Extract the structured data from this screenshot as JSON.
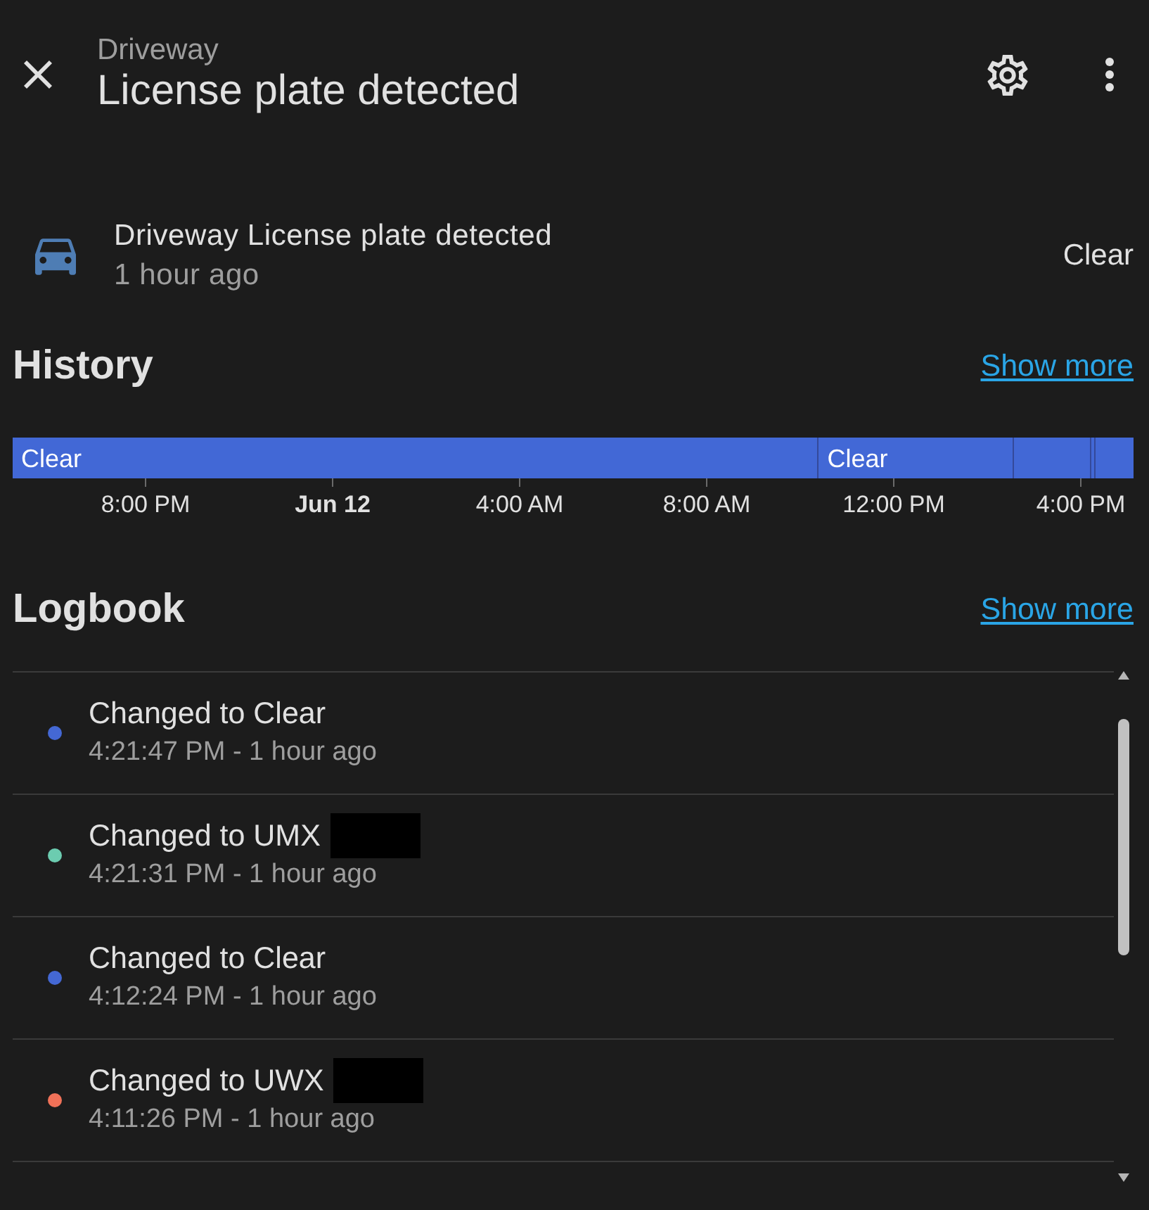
{
  "header": {
    "subtitle": "Driveway",
    "title": "License plate detected"
  },
  "entity": {
    "name": "Driveway License plate detected",
    "last_changed": "1 hour ago",
    "state": "Clear"
  },
  "history": {
    "heading": "History",
    "show_more": "Show more",
    "timeline": {
      "segment_labels": [
        "Clear",
        "Clear"
      ],
      "axis_labels": [
        {
          "label": "8:00 PM",
          "kind": "time"
        },
        {
          "label": "Jun 12",
          "kind": "day"
        },
        {
          "label": "4:00 AM",
          "kind": "time"
        },
        {
          "label": "8:00 AM",
          "kind": "time"
        },
        {
          "label": "12:00 PM",
          "kind": "time"
        },
        {
          "label": "4:00 PM",
          "kind": "time"
        }
      ]
    }
  },
  "logbook": {
    "heading": "Logbook",
    "show_more": "Show more",
    "entries": [
      {
        "message": "Changed to Clear",
        "redacted": false,
        "time": "4:21:47 PM - 1 hour ago",
        "color": "#4468d4"
      },
      {
        "message": "Changed to UMX",
        "redacted": true,
        "time": "4:21:31 PM - 1 hour ago",
        "color": "#6cccb0"
      },
      {
        "message": "Changed to Clear",
        "redacted": false,
        "time": "4:12:24 PM - 1 hour ago",
        "color": "#4468d4"
      },
      {
        "message": "Changed to UWX",
        "redacted": true,
        "time": "4:11:26 PM - 1 hour ago",
        "color": "#f07158"
      }
    ]
  }
}
